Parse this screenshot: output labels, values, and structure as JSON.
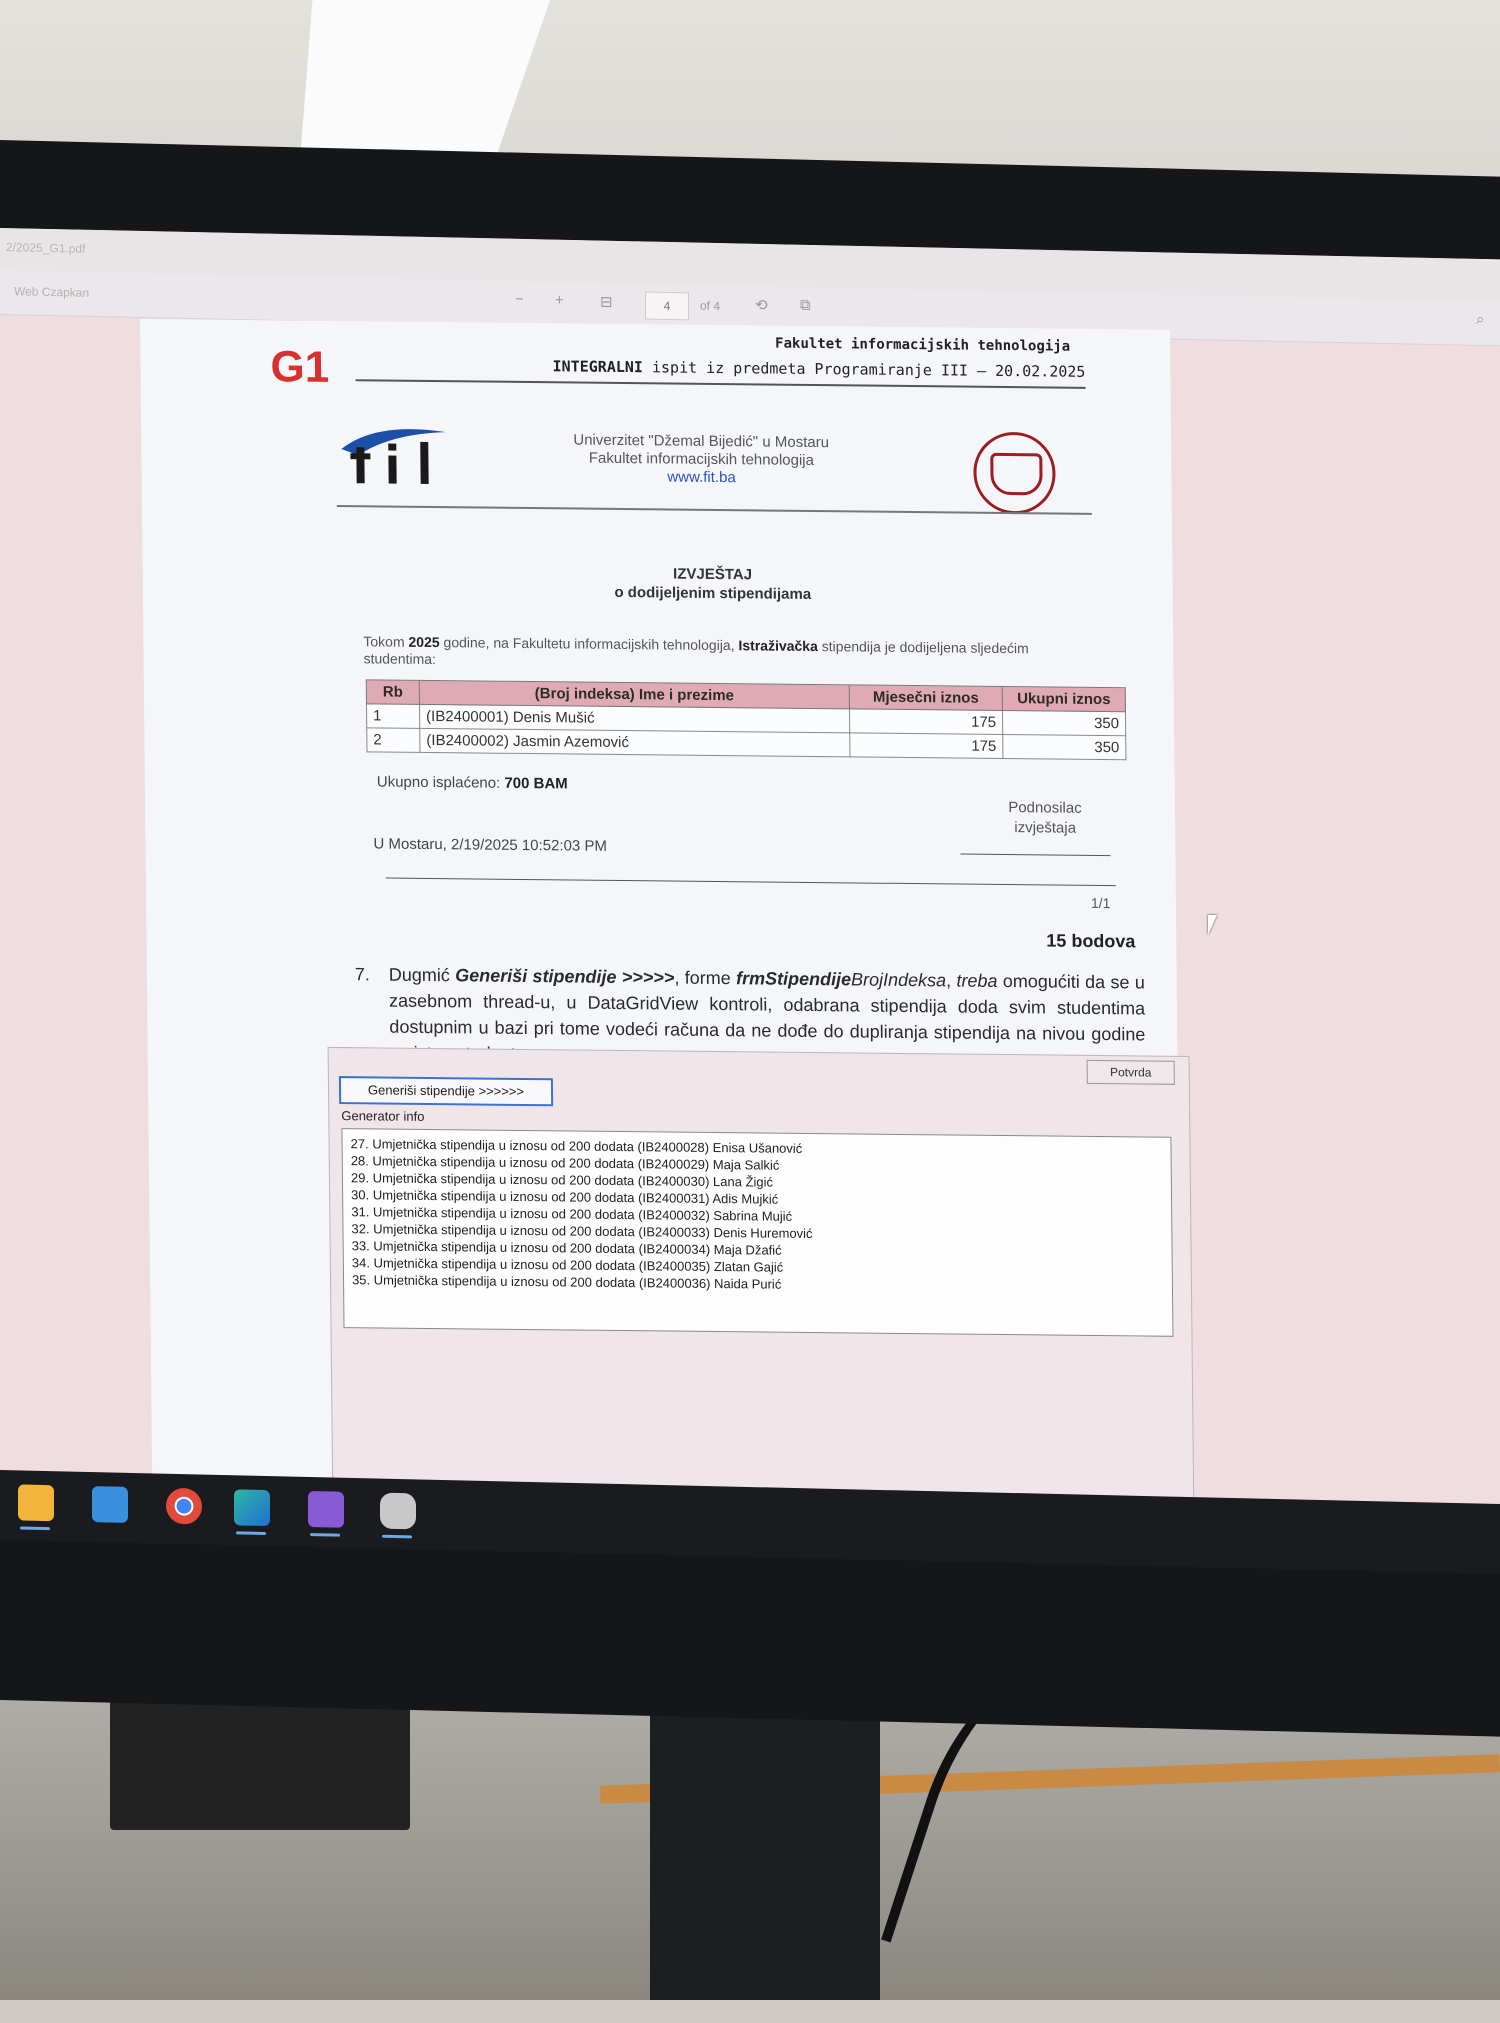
{
  "window": {
    "title": "2/2025_G1.pdf",
    "tab": "Web Czapkan"
  },
  "pdf_toolbar": {
    "zoom_out": "−",
    "zoom_in": "+",
    "fit": "⊟",
    "page_current": "4",
    "page_of": "of 4",
    "rotate": "⟲",
    "view": "⧉",
    "search": "⌕"
  },
  "document": {
    "group_label": "G1",
    "faculty_header": "Fakultet informacijskih tehnologija",
    "exam_bold": "INTEGRALNI",
    "exam_rest": " ispit iz predmeta Programiranje III – 20.02.2025",
    "logo_text": "fit",
    "university": {
      "line1": "Univerzitet \"Džemal Bijedić\" u Mostaru",
      "line2": "Fakultet informacijskih tehnologija",
      "website": "www.fit.ba"
    },
    "report_title": "IZVJEŠTAJ",
    "report_subtitle": "o dodijeljenim stipendijama",
    "intro_pre": "Tokom ",
    "intro_year": "2025",
    "intro_mid": " godine, na Fakultetu informacijskih tehnologija, ",
    "intro_type": "Istraživačka",
    "intro_post": " stipendija je dodijeljena sljedećim studentima:",
    "table": {
      "headers": [
        "Rb",
        "(Broj indeksa) Ime i prezime",
        "Mjesečni iznos",
        "Ukupni iznos"
      ],
      "rows": [
        {
          "rb": "1",
          "student": "(IB2400001) Denis Mušić",
          "monthly": "175",
          "total": "350"
        },
        {
          "rb": "2",
          "student": "(IB2400002) Jasmin Azemović",
          "monthly": "175",
          "total": "350"
        }
      ]
    },
    "total_label": "Ukupno isplaćeno: ",
    "total_value": "700 BAM",
    "signer_line1": "Podnosilac",
    "signer_line2": "izvještaja",
    "place_date": "U Mostaru, 2/19/2025 10:52:03 PM",
    "page_number": "1/1",
    "points": "15 bodova",
    "task": {
      "number": "7.",
      "t1": "Dugmić ",
      "btn_name": "Generiši stipendije >>>>>",
      "t2": ", forme ",
      "form_name": "frmStipendije",
      "form_suffix": "BrojIndeksa",
      "t3": ", ",
      "treba": "treba",
      "t4": " omogućiti da se u zasebnom thread-u, u DataGridView kontroli, odabrana stipendija doda svim studentima dostupnim u bazi pri tome vodeći računa da ne dođe do dupliranja stipendija na nivou godine za istog studenta."
    }
  },
  "form": {
    "confirm_button": "Potvrda",
    "generate_button": "Generiši stipendije >>>>>>",
    "info_label": "Generator info",
    "log": [
      "27. Umjetnička stipendija u iznosu od 200 dodata (IB2400028) Enisa Ušanović",
      "28. Umjetnička stipendija u iznosu od 200 dodata (IB2400029) Maja Salkić",
      "29. Umjetnička stipendija u iznosu od 200 dodata (IB2400030) Lana Žigić",
      "30. Umjetnička stipendija u iznosu od 200 dodata (IB2400031) Adis Mujkić",
      "31. Umjetnička stipendija u iznosu od 200 dodata (IB2400032) Sabrina Mujić",
      "32. Umjetnička stipendija u iznosu od 200 dodata (IB2400033) Denis Huremović",
      "33. Umjetnička stipendija u iznosu od 200 dodata (IB2400034) Maja Džafić",
      "34. Umjetnička stipendija u iznosu od 200 dodata (IB2400035) Zlatan Gajić",
      "35. Umjetnička stipendija u iznosu od 200 dodata (IB2400036) Naida Purić"
    ]
  },
  "taskbar": {
    "apps": [
      {
        "icon": "file-explorer-icon",
        "color": "#f2b53a"
      },
      {
        "icon": "store-icon",
        "color": "#3b8fe0"
      },
      {
        "icon": "chrome-icon",
        "color": "#e24a3b"
      },
      {
        "icon": "edge-icon",
        "color": "#2fb6a4"
      },
      {
        "icon": "visual-studio-icon",
        "color": "#8a5ad6"
      },
      {
        "icon": "database-icon",
        "color": "#c8c8c8"
      }
    ]
  }
}
